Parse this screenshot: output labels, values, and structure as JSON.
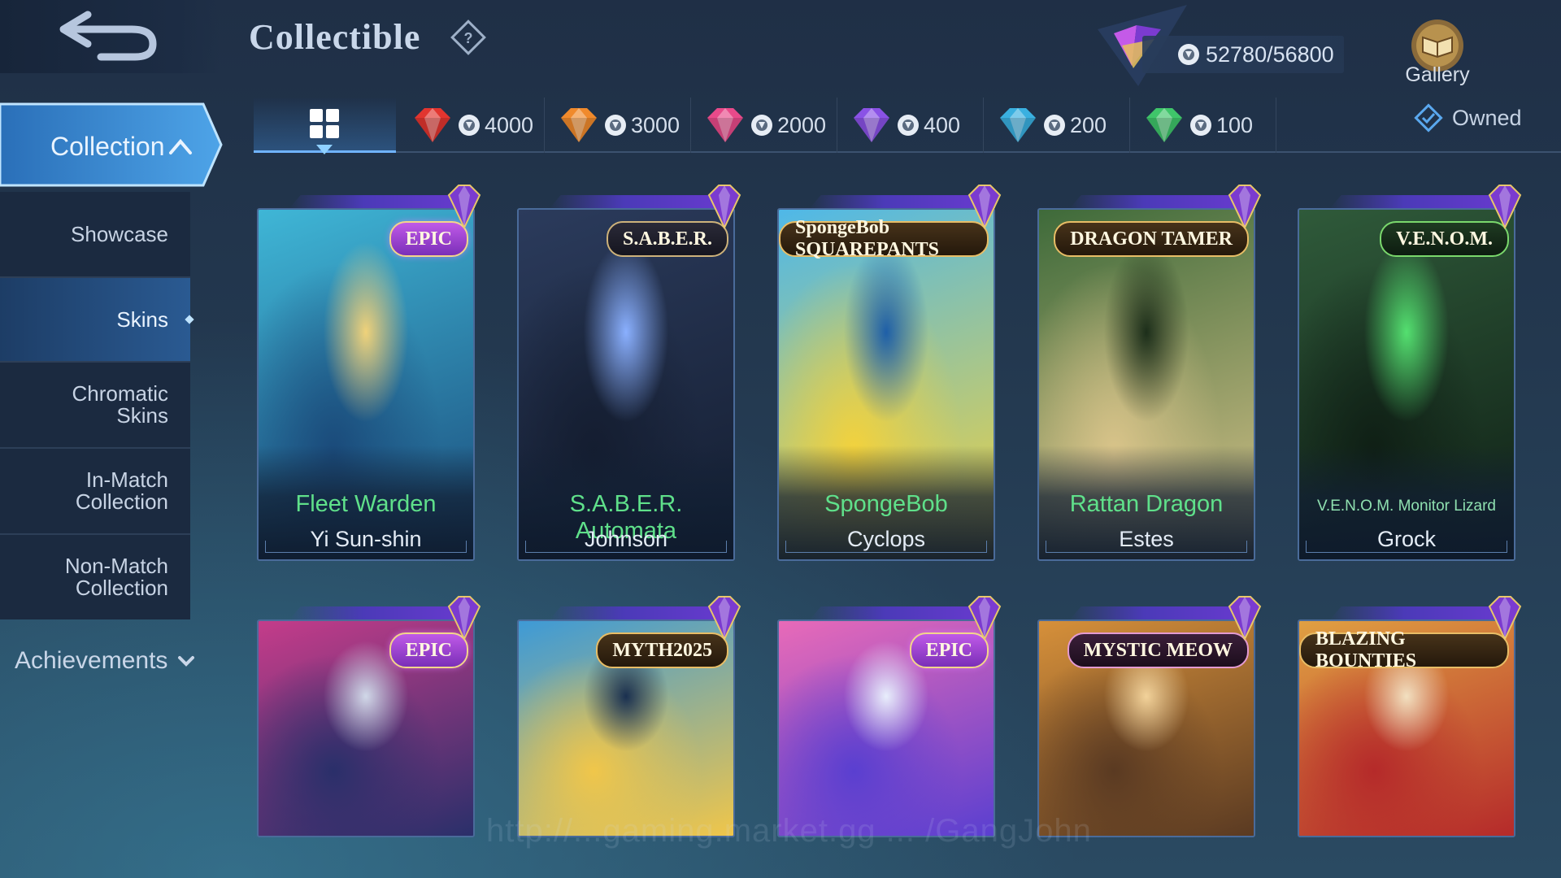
{
  "header": {
    "title": "Collectible",
    "points": "52780/56800",
    "gallery_label": "Gallery"
  },
  "sidebar": {
    "collection_label": "Collection",
    "items": [
      {
        "label": "Showcase"
      },
      {
        "label": "Skins"
      },
      {
        "label": "Chromatic\nSkins"
      },
      {
        "label": "In-Match\nCollection"
      },
      {
        "label": "Non-Match\nCollection"
      }
    ],
    "active_item": "Skins",
    "achievements_label": "Achievements"
  },
  "filters": {
    "tabs": [
      {
        "value": "4000",
        "gem_color": "#e2352f"
      },
      {
        "value": "3000",
        "gem_color": "#f08a2c"
      },
      {
        "value": "2000",
        "gem_color": "#e84a8a"
      },
      {
        "value": "400",
        "gem_color": "#8a52e6"
      },
      {
        "value": "200",
        "gem_color": "#3ab0e0"
      },
      {
        "value": "100",
        "gem_color": "#3fc56a"
      }
    ],
    "owned_label": "Owned"
  },
  "cards": [
    {
      "skin": "Fleet Warden",
      "hero": "Yi Sun-shin",
      "badge": "EPIC",
      "palette": [
        "#3fb6d6",
        "#1a4a7a",
        "#f0d27a"
      ]
    },
    {
      "skin": "S.A.B.E.R. Automata",
      "hero": "Johnson",
      "badge": "S.A.B.E.R.",
      "palette": [
        "#2b3b5c",
        "#141d30",
        "#8ab0ff"
      ]
    },
    {
      "skin": "SpongeBob",
      "hero": "Cyclops",
      "badge": "SpongeBob SQUAREPANTS",
      "palette": [
        "#4fb8e8",
        "#f3d23c",
        "#1e5fa8"
      ]
    },
    {
      "skin": "Rattan Dragon",
      "hero": "Estes",
      "badge": "DRAGON TAMER",
      "palette": [
        "#3e6a3a",
        "#d9c48a",
        "#1c2e1a"
      ]
    },
    {
      "skin": "V.E.N.O.M. Monitor Lizard",
      "hero": "Grock",
      "badge": "V.E.N.O.M.",
      "palette": [
        "#2f5a3a",
        "#0f1f15",
        "#54e070"
      ]
    },
    {
      "skin": "",
      "hero": "",
      "badge": "EPIC",
      "palette": [
        "#c43c8a",
        "#2a2f6a",
        "#d0d8e8"
      ]
    },
    {
      "skin": "",
      "hero": "",
      "badge": "MYTH2025",
      "palette": [
        "#3e9ad6",
        "#f0c64a",
        "#1a3050"
      ]
    },
    {
      "skin": "",
      "hero": "",
      "badge": "EPIC",
      "palette": [
        "#e86ab8",
        "#5a3fd0",
        "#e8eefc"
      ]
    },
    {
      "skin": "",
      "hero": "",
      "badge": "MYSTIC MEOW",
      "palette": [
        "#d6903a",
        "#5a3a22",
        "#f2d29a"
      ]
    },
    {
      "skin": "",
      "hero": "",
      "badge": "BLAZING BOUNTIES",
      "palette": [
        "#e0a042",
        "#b52a2a",
        "#f2e0c0"
      ]
    }
  ]
}
